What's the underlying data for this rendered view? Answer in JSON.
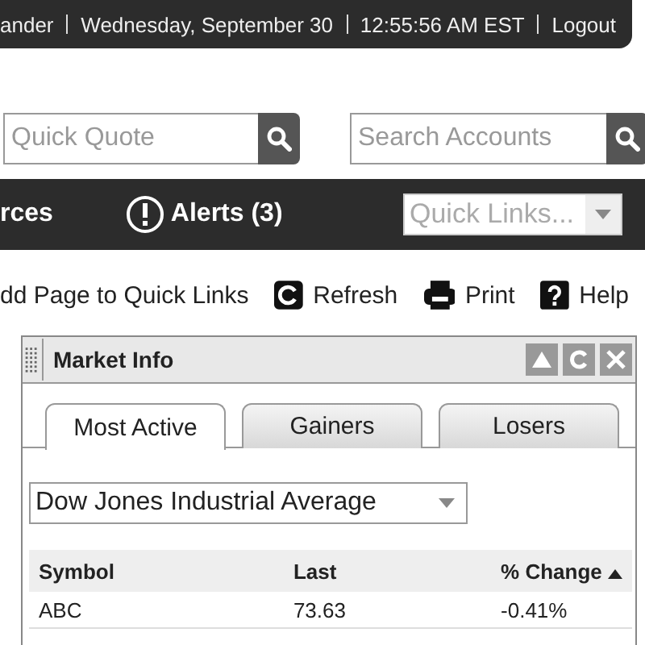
{
  "top_bar": {
    "items": [
      "ander",
      "Wednesday, September 30",
      "12:55:56 AM EST",
      "Logout"
    ]
  },
  "quick_quote": {
    "placeholder": "Quick Quote"
  },
  "search_accounts": {
    "placeholder": "Search Accounts"
  },
  "nav": {
    "items": [
      {
        "label": "rces",
        "kind": "plain"
      },
      {
        "label": "Alerts (3)",
        "kind": "alert"
      }
    ],
    "quick_links": {
      "placeholder": "Quick Links..."
    }
  },
  "tools": [
    {
      "label": "dd Page to Quick Links",
      "kind": "none"
    },
    {
      "label": "Refresh",
      "kind": "refresh"
    },
    {
      "label": "Print",
      "kind": "print"
    },
    {
      "label": "Help",
      "kind": "help"
    }
  ],
  "panel": {
    "title": "Market Info",
    "tabs": [
      {
        "label": "Most Active",
        "selected": true
      },
      {
        "label": "Gainers",
        "selected": false
      },
      {
        "label": "Losers",
        "selected": false
      }
    ],
    "index_select": "Dow Jones Industrial Average",
    "table": {
      "columns": [
        {
          "label": "Symbol",
          "sorted": false
        },
        {
          "label": "Last",
          "sorted": false
        },
        {
          "label": "% Change",
          "sorted": true
        }
      ],
      "rows": [
        [
          "ABC",
          "73.63",
          "-0.41%"
        ]
      ]
    }
  }
}
